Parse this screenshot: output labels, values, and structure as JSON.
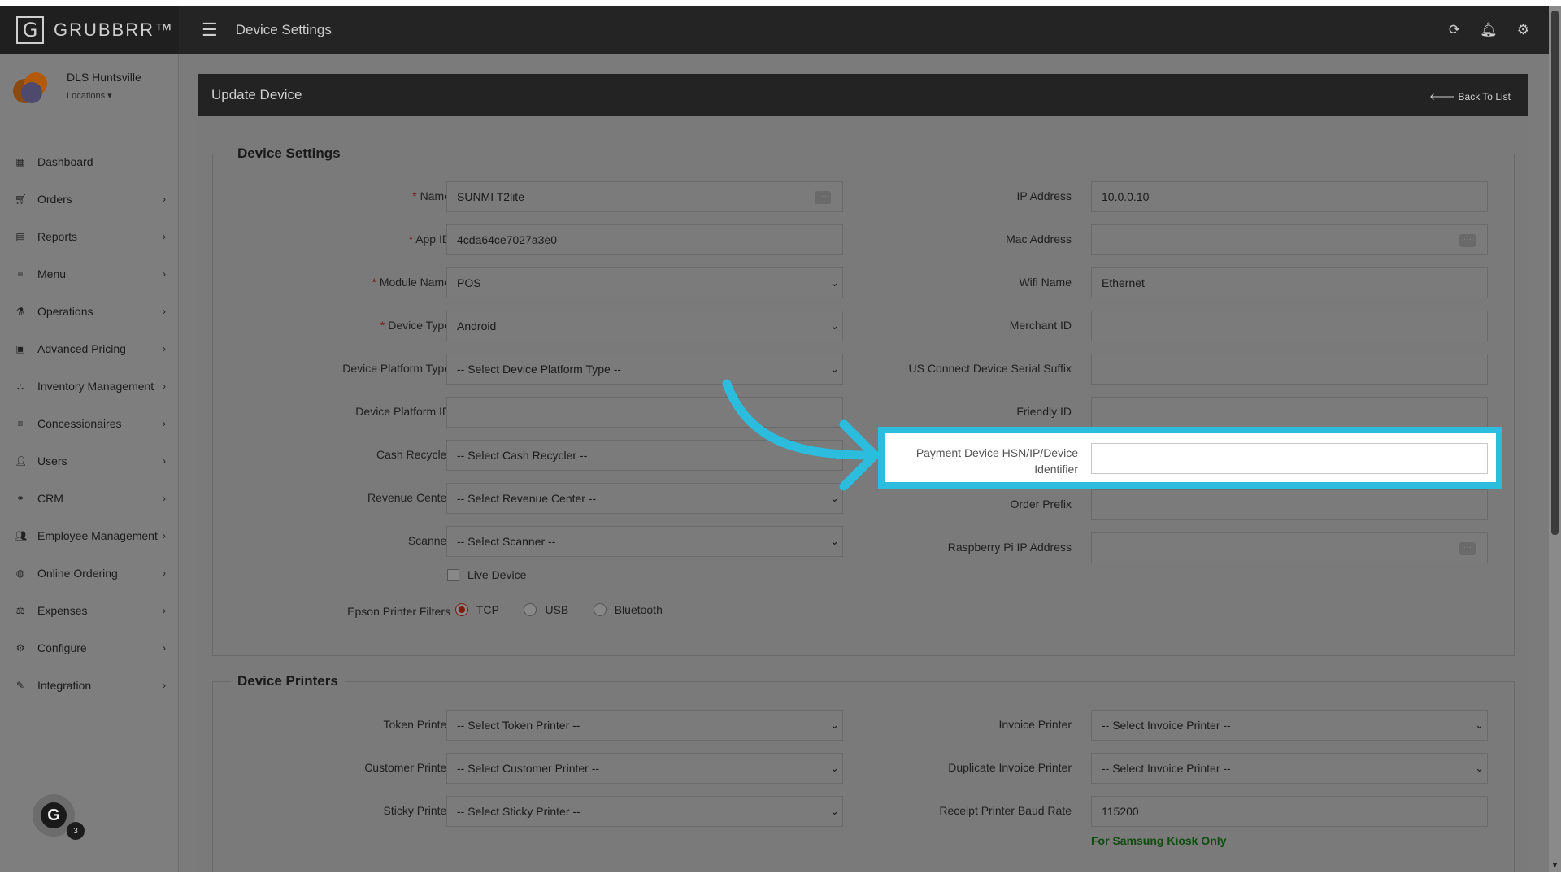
{
  "brand": {
    "logo_letter": "G",
    "name": "GRUBBRR™"
  },
  "topbar": {
    "title": "Device Settings",
    "icons": [
      "refresh-icon",
      "bell-icon",
      "gear-icon"
    ]
  },
  "sidebar": {
    "store_name": "DLS Huntsville",
    "locations_label": "Locations ▾",
    "items": [
      {
        "label": "Dashboard",
        "icon": "dashboard-icon",
        "has_children": false
      },
      {
        "label": "Orders",
        "icon": "cart-icon",
        "has_children": true
      },
      {
        "label": "Reports",
        "icon": "report-icon",
        "has_children": true
      },
      {
        "label": "Menu",
        "icon": "list-icon",
        "has_children": true
      },
      {
        "label": "Operations",
        "icon": "flask-icon",
        "has_children": true
      },
      {
        "label": "Advanced Pricing",
        "icon": "money-icon",
        "has_children": true
      },
      {
        "label": "Inventory Management",
        "icon": "sitemap-icon",
        "has_children": true
      },
      {
        "label": "Concessionaires",
        "icon": "list-icon",
        "has_children": true
      },
      {
        "label": "Users",
        "icon": "user-plus-icon",
        "has_children": true
      },
      {
        "label": "CRM",
        "icon": "link-icon",
        "has_children": true
      },
      {
        "label": "Employee Management",
        "icon": "users-icon",
        "has_children": true
      },
      {
        "label": "Online Ordering",
        "icon": "globe-icon",
        "has_children": true
      },
      {
        "label": "Expenses",
        "icon": "balance-icon",
        "has_children": true
      },
      {
        "label": "Configure",
        "icon": "cog-icon",
        "has_children": true
      },
      {
        "label": "Integration",
        "icon": "plug-icon",
        "has_children": true
      }
    ],
    "badge": {
      "letter": "G",
      "count": "3"
    }
  },
  "panel": {
    "title": "Update Device",
    "back_label": "🡐 Back To List"
  },
  "device_settings": {
    "legend": "Device Settings",
    "left": {
      "name": {
        "label": "Name",
        "required": true,
        "value": "SUNMI T2lite"
      },
      "app_id": {
        "label": "App ID",
        "required": true,
        "value": "4cda64ce7027a3e0"
      },
      "module_name": {
        "label": "Module Name",
        "required": true,
        "value": "POS"
      },
      "device_type": {
        "label": "Device Type",
        "required": true,
        "value": "Android"
      },
      "platform_type": {
        "label": "Device Platform Type",
        "value": "-- Select Device Platform Type --"
      },
      "platform_id": {
        "label": "Device Platform ID",
        "value": ""
      },
      "cash_recycler": {
        "label": "Cash Recycler",
        "value": "-- Select Cash Recycler --"
      },
      "revenue_center": {
        "label": "Revenue Center",
        "value": "-- Select Revenue Center --"
      },
      "scanner": {
        "label": "Scanner",
        "value": "-- Select Scanner --"
      },
      "live_device": {
        "label": "Live Device",
        "checked": false
      },
      "epson_filters": {
        "label": "Epson Printer Filters",
        "options": [
          "TCP",
          "USB",
          "Bluetooth"
        ],
        "selected": "TCP"
      }
    },
    "right": {
      "ip_address": {
        "label": "IP Address",
        "value": "10.0.0.10"
      },
      "mac_address": {
        "label": "Mac Address",
        "value": ""
      },
      "wifi_name": {
        "label": "Wifi Name",
        "value": "Ethernet"
      },
      "merchant_id": {
        "label": "Merchant ID",
        "value": ""
      },
      "us_connect": {
        "label": "US Connect Device Serial Suffix",
        "value": ""
      },
      "friendly_id": {
        "label": "Friendly ID",
        "value": ""
      },
      "payment_device": {
        "label": "Payment Device HSN/IP/Device Identifier",
        "value": ""
      },
      "order_prefix": {
        "label": "Order Prefix",
        "value": ""
      },
      "raspberry_ip": {
        "label": "Raspberry Pi IP Address",
        "value": ""
      }
    }
  },
  "device_printers": {
    "legend": "Device Printers",
    "token_printer": {
      "label": "Token Printer",
      "value": "-- Select Token Printer --"
    },
    "customer_printer": {
      "label": "Customer Printer",
      "value": "-- Select Customer Printer --"
    },
    "sticky_printer": {
      "label": "Sticky Printer",
      "value": "-- Select Sticky Printer --"
    },
    "invoice_printer": {
      "label": "Invoice Printer",
      "value": "-- Select Invoice Printer --"
    },
    "duplicate_invoice_printer": {
      "label": "Duplicate Invoice Printer",
      "value": "-- Select Invoice Printer --"
    },
    "receipt_baud_rate": {
      "label": "Receipt Printer Baud Rate",
      "value": "115200"
    },
    "samsung_note": "For Samsung Kiosk Only"
  },
  "colors": {
    "highlight": "#2bbcde",
    "sidebar_bg": "#7e7e7e",
    "topbar_bg": "#242424",
    "required": "#7a1a1a",
    "note_green": "#0d4d0d"
  }
}
